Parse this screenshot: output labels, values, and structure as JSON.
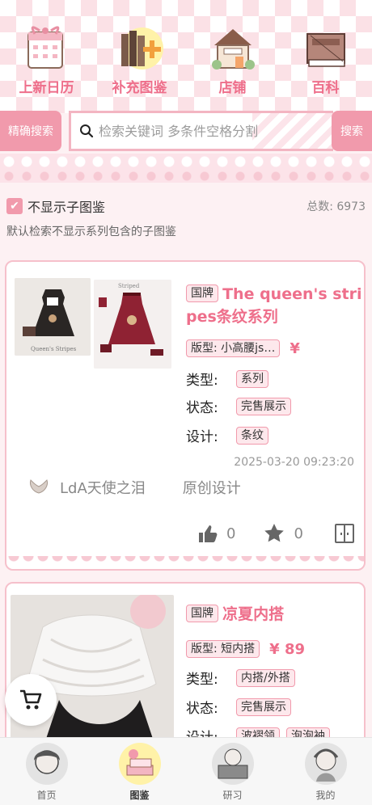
{
  "topnav": [
    {
      "label": "上新日历",
      "icon": "calendar-icon"
    },
    {
      "label": "补充图鉴",
      "icon": "books-plus-icon"
    },
    {
      "label": "店铺",
      "icon": "shop-icon"
    },
    {
      "label": "百科",
      "icon": "encyclopedia-icon"
    }
  ],
  "search": {
    "precise_label": "精确搜索",
    "placeholder": "检索关键词 多条件空格分割",
    "button_label": "搜索"
  },
  "filter": {
    "checkbox_label": "不显示子图鉴",
    "total": "总数: 6973",
    "hint": "默认检索不显示系列包含的子图鉴"
  },
  "cards": [
    {
      "badge": "国牌",
      "title": "The queen's stripes条纹系列",
      "fit_tag": "版型: 小高腰js…",
      "price": "¥",
      "type_label": "类型:",
      "type": "系列",
      "status_label": "状态:",
      "status": "完售展示",
      "design_label": "设计:",
      "design": [
        "条纹"
      ],
      "datetime": "2025-03-20 09:23:20",
      "shop": "LdA天使之泪",
      "origin": "原创设计",
      "likes": "0",
      "favorites": "0"
    },
    {
      "badge": "国牌",
      "title": "凉夏内搭",
      "fit_tag": "版型: 短内搭",
      "price": "¥ 89",
      "type_label": "类型:",
      "type": "内搭/外搭",
      "status_label": "状态:",
      "status": "完售展示",
      "design_label": "设计:",
      "design": [
        "波褶领",
        "泡泡袖"
      ]
    }
  ],
  "tabbar": [
    {
      "label": "首页"
    },
    {
      "label": "图鉴"
    },
    {
      "label": "研习"
    },
    {
      "label": "我的"
    }
  ],
  "colors": {
    "accent": "#ee6f8b",
    "pink_button": "#f19aac",
    "background": "#fdf1f3"
  }
}
